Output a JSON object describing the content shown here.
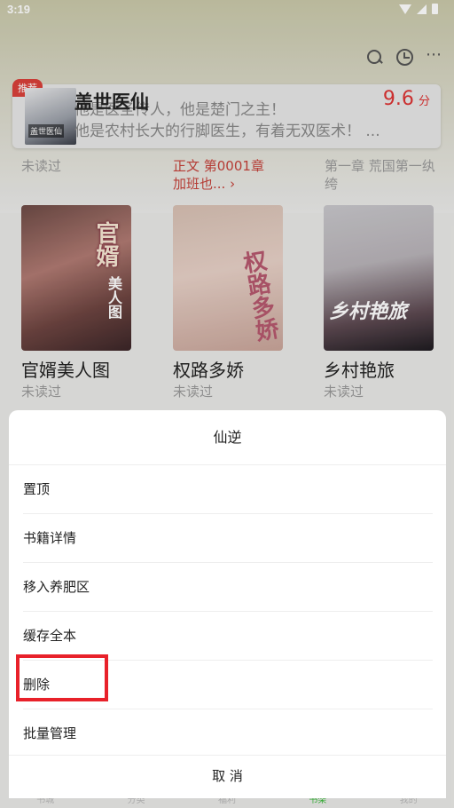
{
  "status_bar": {
    "time": "3:19"
  },
  "top_actions": {
    "search": "search-icon",
    "history": "clock-icon",
    "more": "⋯"
  },
  "recommended": {
    "badge": "推荐",
    "cover_title": "盖世医仙",
    "title": "盖世医仙",
    "desc_line1": "他是医圣传人，他是楚门之主！",
    "desc_line2": "他是农村长大的行脚医生，有着无双医术！ ...",
    "score": "9.6",
    "score_unit": "分"
  },
  "prev_row": {
    "book1_status": "未读过",
    "book2_progress": "正文 第0001章 加班也... ›",
    "book3_progress": "第一章 荒国第一纨绔"
  },
  "books": [
    {
      "title": "官婿美人图",
      "status": "未读过",
      "cover_title": "官婿",
      "cover_sub": "美人图"
    },
    {
      "title": "权路多娇",
      "status": "未读过",
      "cover_title": "权路多娇"
    },
    {
      "title": "乡村艳旅",
      "status": "未读过",
      "cover_title": "乡村艳旅"
    }
  ],
  "sheet": {
    "title": "仙逆",
    "items": [
      "置顶",
      "书籍详情",
      "移入养肥区",
      "缓存全本",
      "删除",
      "批量管理"
    ],
    "cancel": "取 消"
  },
  "bottom_nav": [
    "书城",
    "分类",
    "福利",
    "书架",
    "我的"
  ],
  "colors": {
    "accent_red": "#d33",
    "highlight": "#e8212a"
  }
}
